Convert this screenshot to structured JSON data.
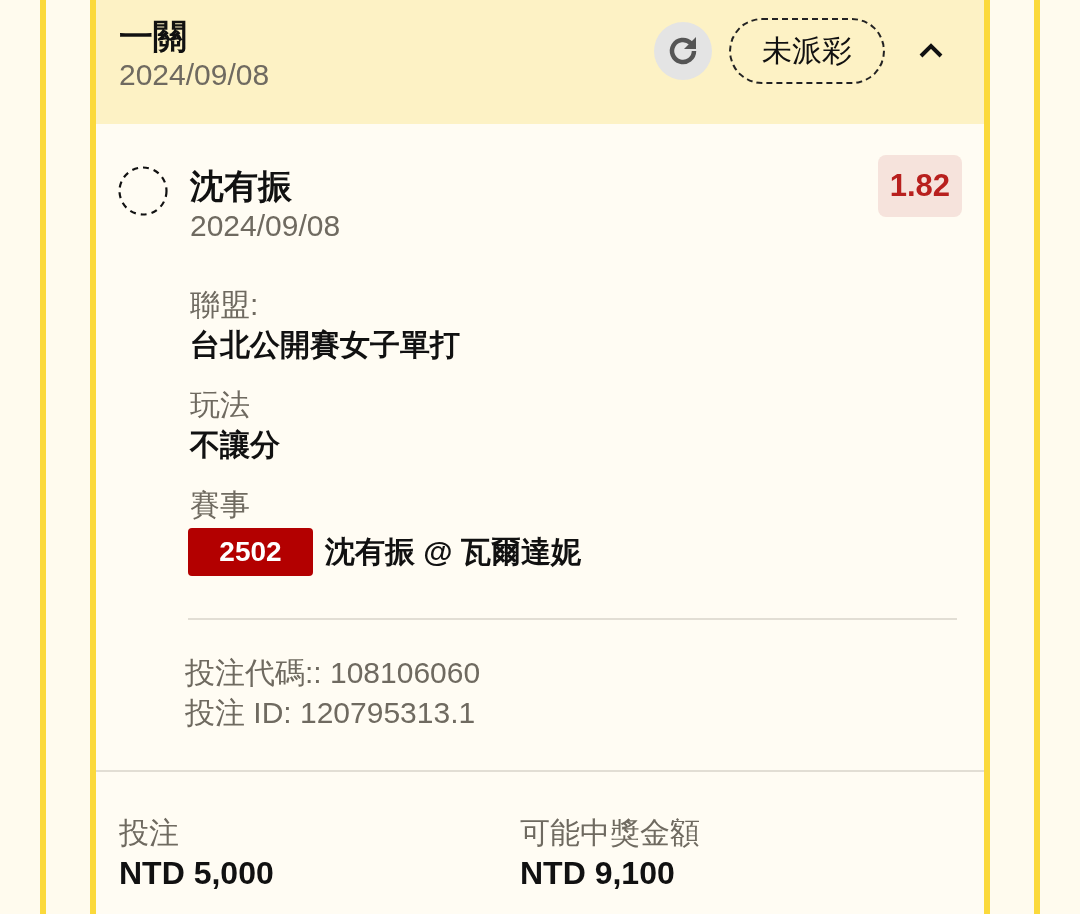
{
  "bet": {
    "title": "一關",
    "date": "2024/09/08",
    "status": "未派彩",
    "expanded": true,
    "selection": {
      "name": "沈有振",
      "date": "2024/09/08",
      "odds": "1.82",
      "details": [
        {
          "kind": "text",
          "label": "聯盟:",
          "value": "台北公開賽女子單打"
        },
        {
          "kind": "text",
          "label": "玩法",
          "value": "不讓分"
        },
        {
          "kind": "event",
          "label": "賽事",
          "event_number": "2502",
          "value": "沈有振 @ 瓦爾達妮"
        }
      ]
    },
    "codes": [
      "投注代碼:: 108106060",
      "投注 ID: 120795313.1"
    ],
    "summary": [
      {
        "label": "投注",
        "value": "NTD 5,000"
      },
      {
        "label": "可能中獎金額",
        "value": "NTD 9,100"
      }
    ]
  }
}
